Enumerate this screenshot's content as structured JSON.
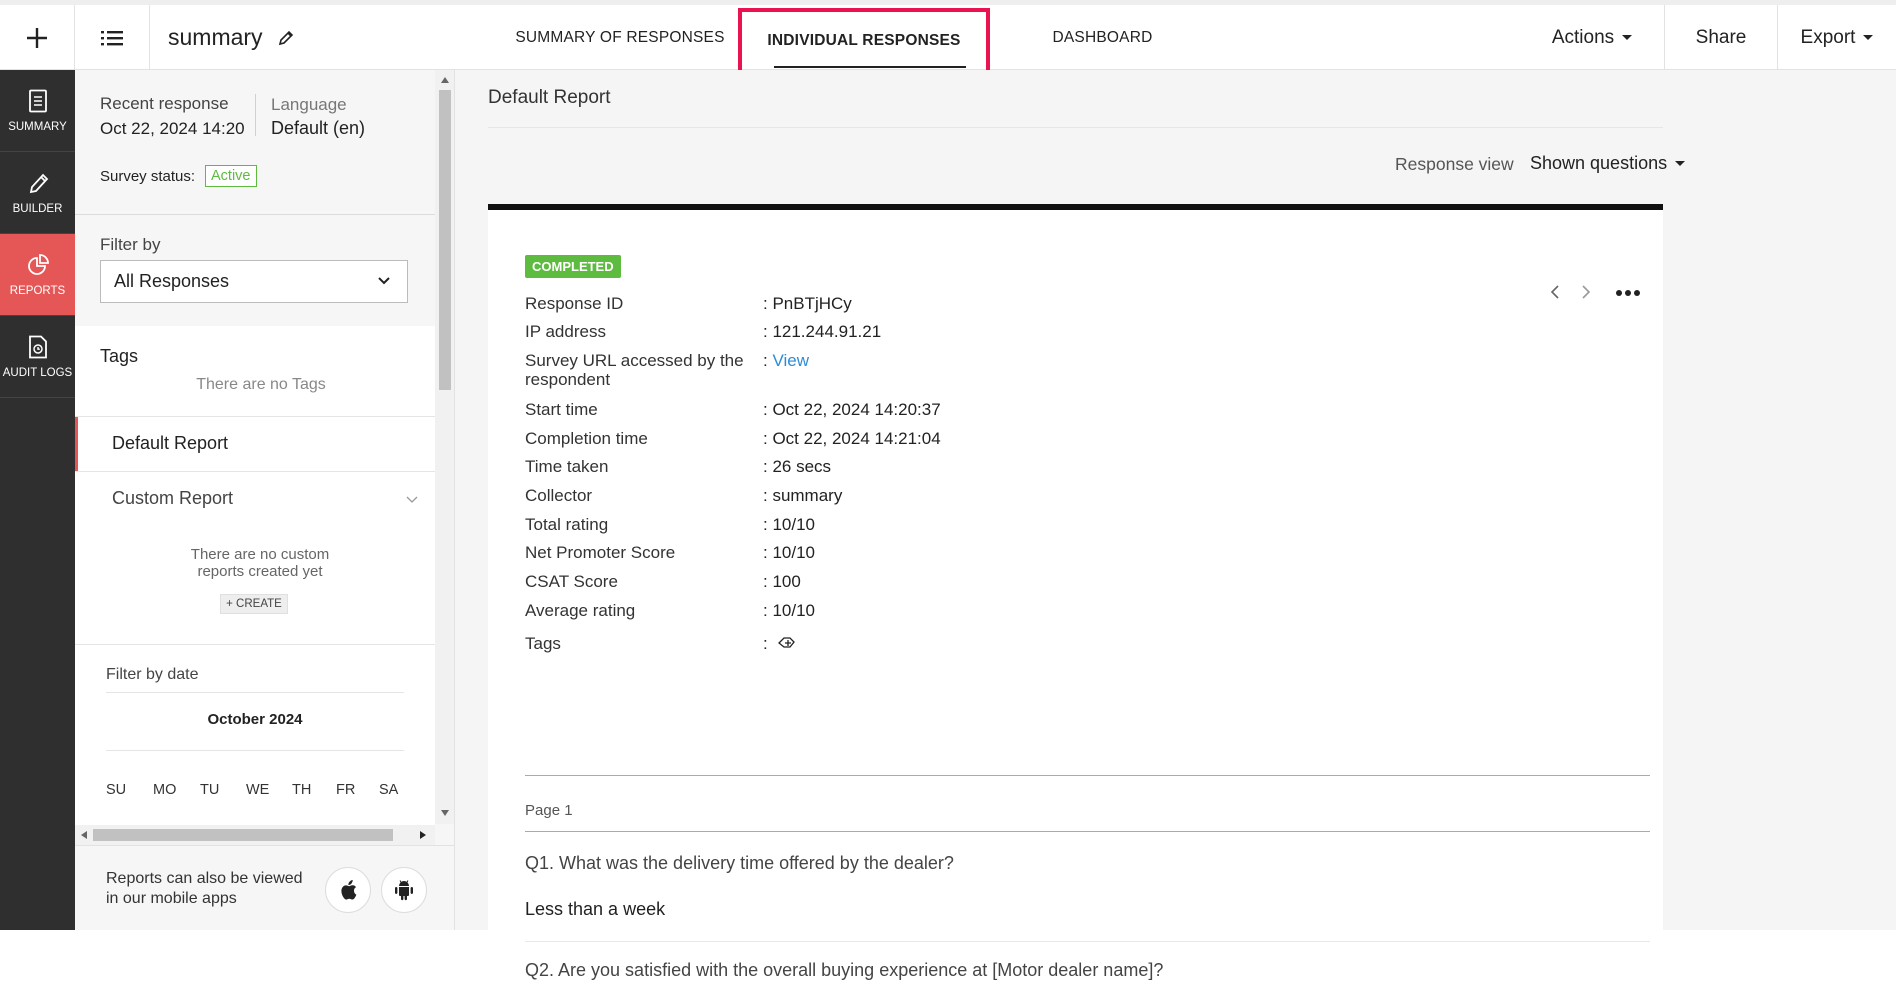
{
  "topbar": {
    "title": "summary",
    "tabs": [
      "SUMMARY OF RESPONSES",
      "INDIVIDUAL RESPONSES",
      "DASHBOARD"
    ],
    "actions_label": "Actions",
    "share_label": "Share",
    "export_label": "Export"
  },
  "rail": {
    "items": [
      "SUMMARY",
      "BUILDER",
      "REPORTS",
      "AUDIT LOGS"
    ]
  },
  "panel": {
    "recent_label": "Recent response",
    "recent_value": "Oct 22, 2024 14:20",
    "language_label": "Language",
    "language_value": "Default (en)",
    "status_label": "Survey status:",
    "status_value": "Active",
    "filter_label": "Filter by",
    "filter_value": "All Responses",
    "tags_title": "Tags",
    "tags_empty": "There are no Tags",
    "default_report": "Default Report",
    "custom_report": "Custom Report",
    "custom_empty_1": "There are no custom",
    "custom_empty_2": "reports created yet",
    "create_label": "+ CREATE",
    "date_filter_label": "Filter by date",
    "month": "October 2024",
    "weekdays": [
      "SU",
      "MO",
      "TU",
      "WE",
      "TH",
      "FR",
      "SA"
    ],
    "mobile_text_1": "Reports can also be viewed",
    "mobile_text_2": "in our mobile apps"
  },
  "main": {
    "report_title": "Default Report",
    "response_view_label": "Response view",
    "response_view_value": "Shown questions",
    "status_badge": "COMPLETED",
    "fields": [
      {
        "k": "Response ID",
        "v": ": PnBTjHCy"
      },
      {
        "k": "IP address",
        "v": ": 121.244.91.21"
      },
      {
        "k": "Survey URL accessed by the respondent",
        "v": ":",
        "link": "View"
      },
      {
        "k": "Start time",
        "v": ": Oct 22, 2024 14:20:37"
      },
      {
        "k": "Completion time",
        "v": ": Oct 22, 2024 14:21:04"
      },
      {
        "k": "Time taken",
        "v": ": 26 secs"
      },
      {
        "k": "Collector",
        "v": ": summary"
      },
      {
        "k": "Total rating",
        "v": ": 10/10"
      },
      {
        "k": "Net Promoter Score",
        "v": ": 10/10"
      },
      {
        "k": "CSAT Score",
        "v": ": 100"
      },
      {
        "k": "Average rating",
        "v": ": 10/10"
      },
      {
        "k": "Tags",
        "v": ":"
      }
    ],
    "page_label": "Page 1",
    "q1": "Q1. What was the delivery time offered by the dealer?",
    "a1": "Less than a week",
    "q2": "Q2. Are you satisfied with the overall buying experience at [Motor dealer name]?"
  }
}
